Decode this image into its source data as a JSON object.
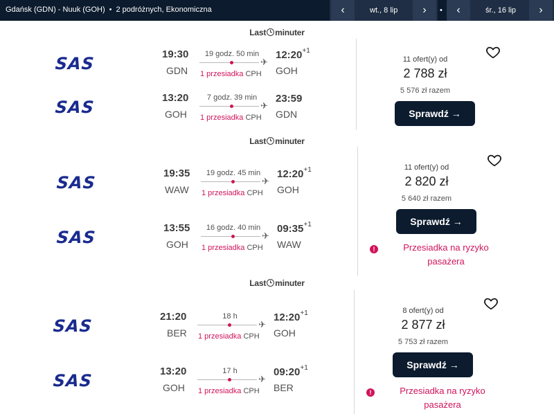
{
  "topbar": {
    "route": "Gdańsk (GDN) - Nuuk (GOH)",
    "travellers": "2 podróżnych, Ekonomiczna",
    "dot": "•",
    "date_out": "wt., 8 lip",
    "date_back": "śr., 16 lip",
    "prev_arrow": "‹",
    "next_arrow": "›"
  },
  "provider_name_a": "Last",
  "provider_name_b": "minuter",
  "results": [
    {
      "offers": "11 ofert(y) od",
      "price": "2 788 zł",
      "total": "5 576 zł razem",
      "button": "Sprawdź →",
      "legs": [
        {
          "airline": "SAS",
          "dep_time": "19:30",
          "dep_code": "GDN",
          "duration": "19 godz. 50 min",
          "arr_time": "12:20",
          "arr_plus": "+1",
          "arr_code": "GOH",
          "stops": "1 przesiadka",
          "via": "CPH"
        },
        {
          "airline": "SAS",
          "dep_time": "13:20",
          "dep_code": "GOH",
          "duration": "7 godz. 39 min",
          "arr_time": "23:59",
          "arr_plus": "",
          "arr_code": "GDN",
          "stops": "1 przesiadka",
          "via": "CPH"
        }
      ]
    },
    {
      "offers": "11 ofert(y) od",
      "price": "2 820 zł",
      "total": "5 640 zł razem",
      "button": "Sprawdź →",
      "warning": "Przesiadka na ryzyko pasażera",
      "legs": [
        {
          "airline": "SAS",
          "dep_time": "19:35",
          "dep_code": "WAW",
          "duration": "19 godz. 45 min",
          "arr_time": "12:20",
          "arr_plus": "+1",
          "arr_code": "GOH",
          "stops": "1 przesiadka",
          "via": "CPH"
        },
        {
          "airline": "SAS",
          "dep_time": "13:55",
          "dep_code": "GOH",
          "duration": "16 godz. 40 min",
          "arr_time": "09:35",
          "arr_plus": "+1",
          "arr_code": "WAW",
          "stops": "1 przesiadka",
          "via": "CPH"
        }
      ]
    },
    {
      "offers": "8 ofert(y) od",
      "price": "2 877 zł",
      "total": "5 753 zł razem",
      "button": "Sprawdź →",
      "warning": "Przesiadka na ryzyko pasażera",
      "legs": [
        {
          "airline": "SAS",
          "dep_time": "21:20",
          "dep_code": "BER",
          "duration": "18 h",
          "arr_time": "12:20",
          "arr_plus": "+1",
          "arr_code": "GOH",
          "stops": "1 przesiadka",
          "via": "CPH"
        },
        {
          "airline": "SAS",
          "dep_time": "13:20",
          "dep_code": "GOH",
          "duration": "17 h",
          "arr_time": "09:20",
          "arr_plus": "+1",
          "arr_code": "BER",
          "stops": "1 przesiadka",
          "via": "CPH"
        }
      ]
    }
  ],
  "icons": {
    "plane": "✈",
    "warning": "!"
  },
  "colors": {
    "navy": "#0c1b2e",
    "accent": "#d0145a",
    "sas_blue": "#1a2b8f"
  }
}
